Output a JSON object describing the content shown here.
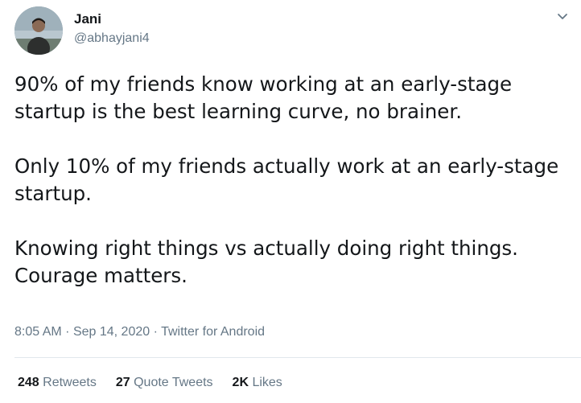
{
  "user": {
    "display_name": "Jani",
    "handle": "@abhayjani4"
  },
  "tweet": {
    "paragraphs": [
      "90% of my friends know working at an early-stage\nstartup is the best learning curve, no brainer.",
      "Only 10% of my friends actually work at an early-stage\nstartup.",
      "Knowing right things vs actually doing right things.\nCourage matters."
    ],
    "time": "8:05 AM",
    "date": "Sep 14, 2020",
    "source": "Twitter for Android",
    "separator": "·"
  },
  "stats": {
    "retweets_count": "248",
    "retweets_label": "Retweets",
    "quote_count": "27",
    "quote_label": "Quote Tweets",
    "likes_count": "2K",
    "likes_label": "Likes"
  },
  "icons": {
    "more": "chevron-down-icon",
    "avatar": "avatar"
  },
  "colors": {
    "text": "#14171a",
    "secondary": "#657786",
    "divider": "#e1e8ed"
  }
}
